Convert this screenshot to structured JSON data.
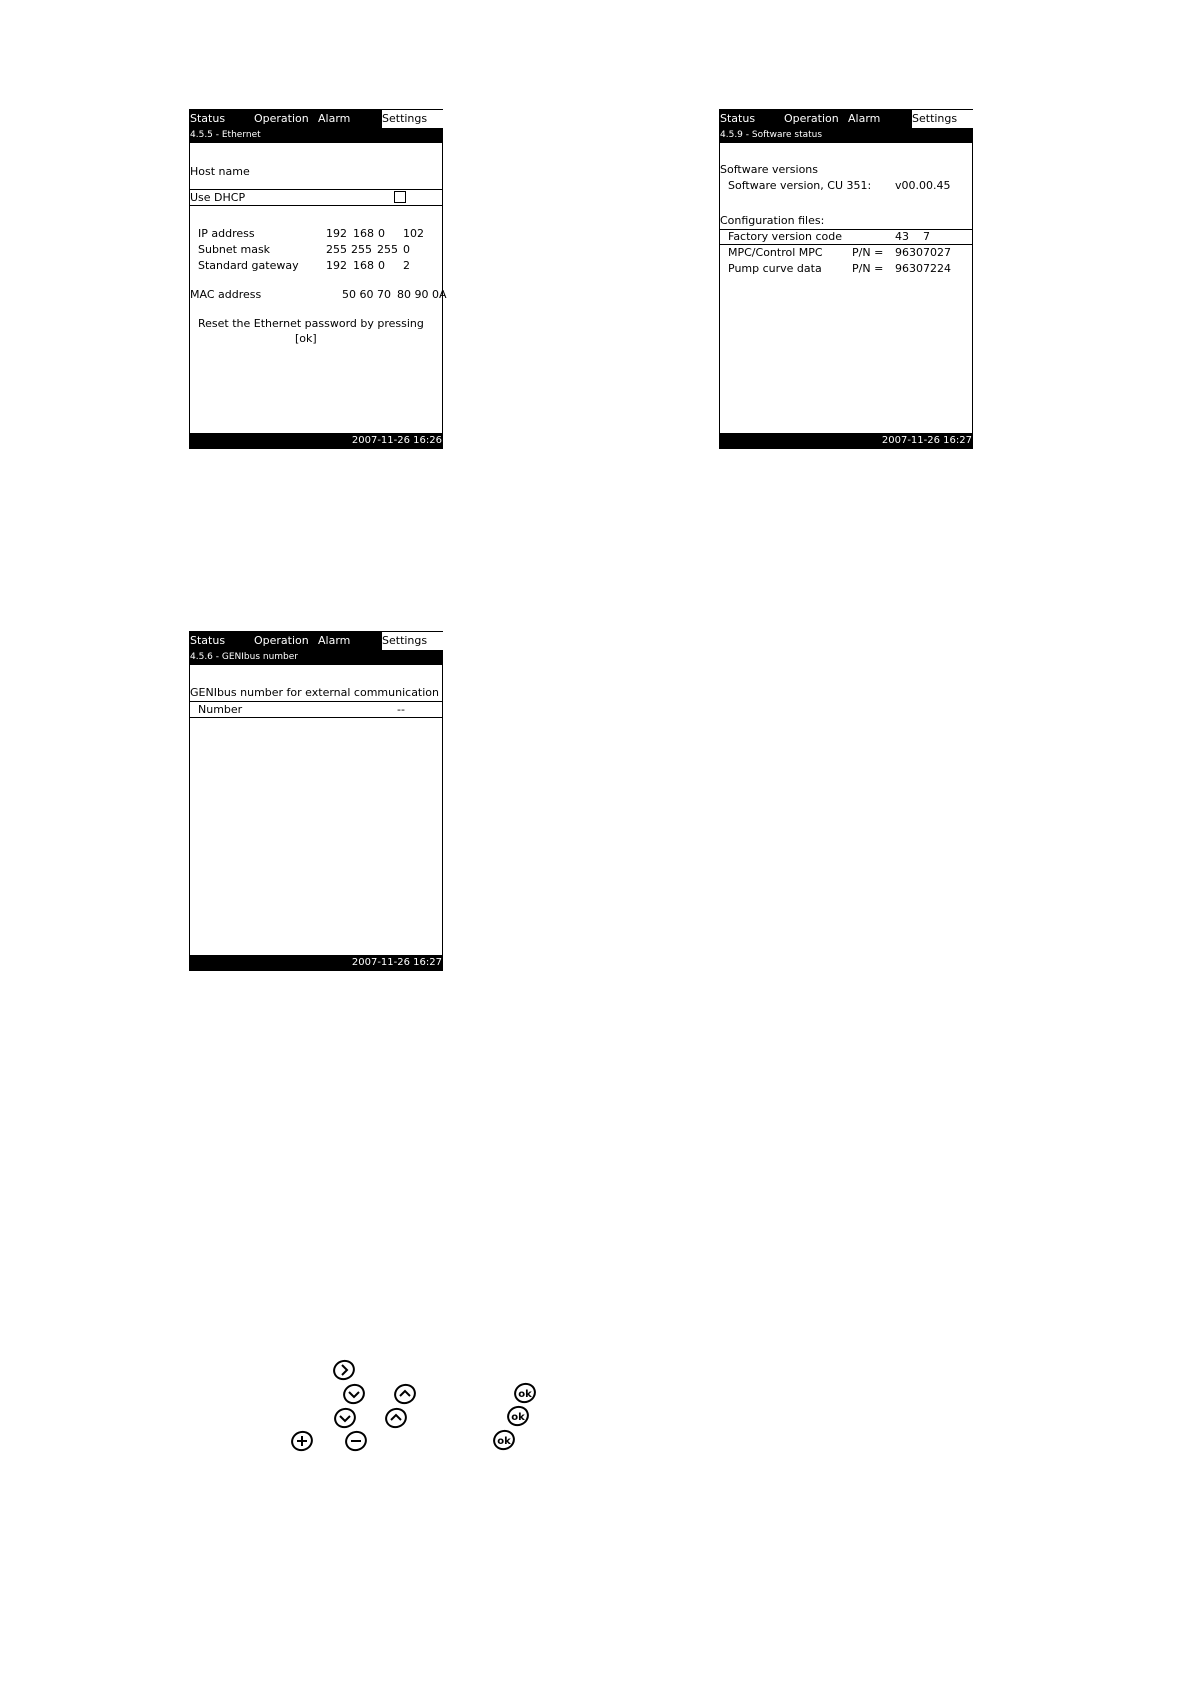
{
  "tabs": {
    "status": "Status",
    "operation": "Operation",
    "alarm": "Alarm",
    "settings": "Settings"
  },
  "ethernet": {
    "title": "4.5.5 - Ethernet",
    "host_name_label": "Host name",
    "use_dhcp_label": "Use DHCP",
    "use_dhcp_checked": false,
    "ip": {
      "label": "IP address",
      "values": [
        "192",
        "168",
        "0",
        "102"
      ]
    },
    "subnet": {
      "label": "Subnet mask",
      "values": [
        "255",
        "255",
        "255",
        "0"
      ]
    },
    "gateway": {
      "label": "Standard gateway",
      "values": [
        "192",
        "168",
        "0",
        "2"
      ]
    },
    "mac": {
      "label": "MAC address",
      "value_a": "50 60 70",
      "value_b": "80 90 0A"
    },
    "reset_text": "Reset the Ethernet password by pressing",
    "reset_key": "[ok]",
    "footer": "2007-11-26  16:26"
  },
  "software": {
    "title": "4.5.9 - Software status",
    "versions_heading": "Software versions",
    "sw_label": "Software version, CU 351:",
    "sw_value": "v00.00.45",
    "config_heading": "Configuration files:",
    "factory_label": "Factory version code",
    "factory_value_a": "43",
    "factory_value_b": "7",
    "rows": [
      {
        "label": "MPC/Control MPC",
        "pn": "P/N =",
        "value": "96307027"
      },
      {
        "label": "Pump curve data",
        "pn": "P/N =",
        "value": "96307224"
      }
    ],
    "footer": "2007-11-26  16:27"
  },
  "genibus": {
    "title": "4.5.6 - GENIbus number",
    "heading": "GENIbus number for external communication",
    "number_label": "Number",
    "number_value": "--",
    "footer": "2007-11-26  16:27"
  },
  "keys": {
    "ok": "ok",
    "plus": "+",
    "minus": "−"
  }
}
